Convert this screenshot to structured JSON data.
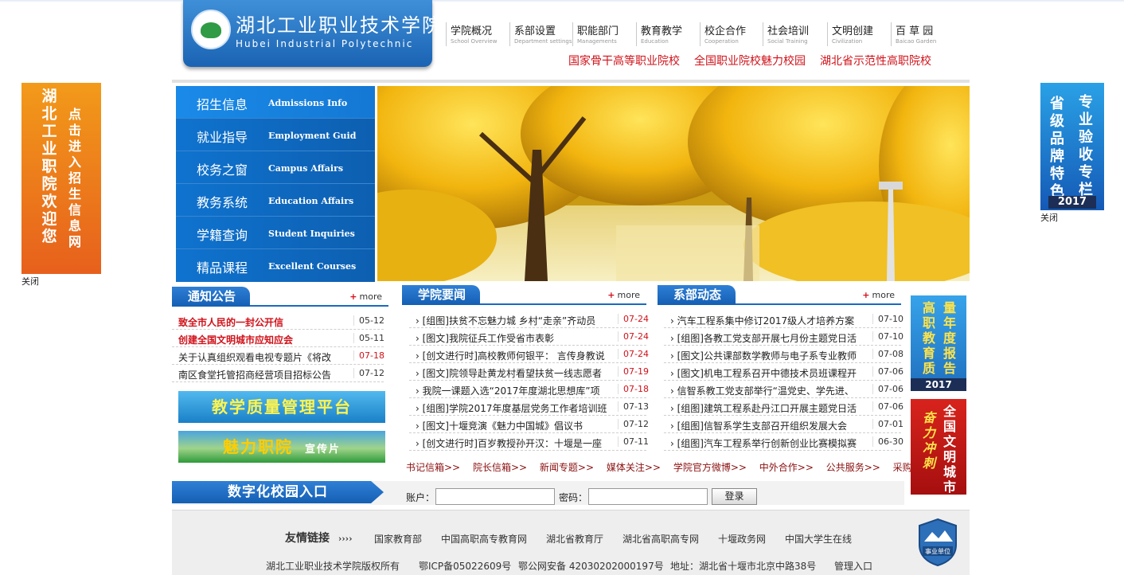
{
  "header": {
    "logo_cn": "湖北工业职业技术学院",
    "logo_en": "Hubei Industrial Polytechnic",
    "nav": [
      {
        "cn": "学院概况",
        "en": "School Overview"
      },
      {
        "cn": "系部设置",
        "en": "Department settings"
      },
      {
        "cn": "职能部门",
        "en": "Managements"
      },
      {
        "cn": "教育教学",
        "en": "Education"
      },
      {
        "cn": "校企合作",
        "en": "Cooperation"
      },
      {
        "cn": "社会培训",
        "en": "Social Training"
      },
      {
        "cn": "文明创建",
        "en": "Civilization"
      },
      {
        "cn": "百 草 园",
        "en": "Baicao Garden"
      }
    ],
    "slogans": [
      "国家骨干高等职业院校",
      "全国职业院校魅力校园",
      "湖北省示范性高职院校"
    ]
  },
  "side_menu": [
    {
      "cn": "招生信息",
      "en": "Admissions Info"
    },
    {
      "cn": "就业指导",
      "en": "Employment Guid"
    },
    {
      "cn": "校务之窗",
      "en": "Campus Affairs"
    },
    {
      "cn": "教务系统",
      "en": "Education Affairs"
    },
    {
      "cn": "学籍查询",
      "en": "Student Inquiries"
    },
    {
      "cn": "精品课程",
      "en": "Excellent Courses"
    }
  ],
  "float_left": {
    "text1": "湖北工业职院欢迎您",
    "text2": "点击进入招生信息网",
    "close": "关闭"
  },
  "float_right": {
    "text1": "省级品牌特色",
    "text2": "专业验收专栏",
    "year": "2017",
    "close": "关闭"
  },
  "notice": {
    "title": "通知公告",
    "more": "more",
    "items": [
      {
        "title": "致全市人民的一封公开信",
        "date": "05-12",
        "title_red": true,
        "date_red": false
      },
      {
        "title": "创建全国文明城市应知应会",
        "date": "05-11",
        "title_red": true,
        "date_red": false
      },
      {
        "title": "关于认真组织观看电视专题片《将改",
        "date": "07-18",
        "title_red": false,
        "date_red": true
      },
      {
        "title": "南区食堂托管招商经营项目招标公告",
        "date": "07-12",
        "title_red": false,
        "date_red": false
      }
    ],
    "banner1": "教学质量管理平台",
    "banner2": "魅力职院",
    "banner2_sub": "宣传片"
  },
  "college_news": {
    "title": "学院要闻",
    "more": "more",
    "items": [
      {
        "title": "[组图]扶贫不忘魅力城 乡村“走亲”齐动员",
        "date": "07-24",
        "date_red": true
      },
      {
        "title": "[图文]我院征兵工作受省市表彰",
        "date": "07-24",
        "date_red": true
      },
      {
        "title": "[创文进行时]高校教师何银平： 言传身教说",
        "date": "07-24",
        "date_red": true
      },
      {
        "title": "[图文]院领导赴黄龙村看望扶贫一线志愿者",
        "date": "07-19",
        "date_red": true
      },
      {
        "title": "我院一课题入选“2017年度湖北思想库”项",
        "date": "07-18",
        "date_red": true
      },
      {
        "title": "[组图]学院2017年度基层党务工作者培训班",
        "date": "07-13",
        "date_red": false
      },
      {
        "title": "[图文]十堰竞演《魅力中国城》倡议书",
        "date": "07-12",
        "date_red": false
      },
      {
        "title": "[创文进行时]百岁教授孙开汉：十堰是一座",
        "date": "07-11",
        "date_red": false
      }
    ]
  },
  "dept_news": {
    "title": "系部动态",
    "more": "more",
    "items": [
      {
        "title": "汽车工程系集中修订2017级人才培养方案",
        "date": "07-10"
      },
      {
        "title": "[组图]各教工党支部开展七月份主题党日活",
        "date": "07-10"
      },
      {
        "title": "[图文]公共课部数学教师与电子系专业教师",
        "date": "07-08"
      },
      {
        "title": "[图文]机电工程系召开中德技术员班课程开",
        "date": "07-06"
      },
      {
        "title": "信智系教工党支部举行“温党史、学先进、",
        "date": "07-06"
      },
      {
        "title": "[组图]建筑工程系赴丹江口开展主题党日活",
        "date": "07-06"
      },
      {
        "title": "[组图]信智系学生支部召开组织发展大会",
        "date": "07-01"
      },
      {
        "title": "[组图]汽车工程系举行创新创业比赛模拟赛",
        "date": "06-30"
      }
    ]
  },
  "quick_links": [
    "书记信箱>>",
    "院长信箱>>",
    "新闻专题>>",
    "媒体关注>>",
    "学院官方微博>>",
    "中外合作>>",
    "公共服务>>",
    "采购公告>>"
  ],
  "login": {
    "campus_entry": "数字化校园入口",
    "account_label": "账户：",
    "password_label": "密码：",
    "login_button": "登录"
  },
  "right_ads": {
    "ad1_text1": "高职教育质",
    "ad1_text2": "量年度报告",
    "ad1_year": "2017",
    "ad2_text1": "全国文明城市",
    "ad2_text2": "奋力冲刺"
  },
  "footer": {
    "friend_title": "友情链接",
    "friend_arrows": "››››",
    "links": [
      "国家教育部",
      "中国高职高专教育网",
      "湖北省教育厅",
      "湖北省高职高专网",
      "十堰政务网",
      "中国大学生在线"
    ],
    "copyright": "湖北工业职业技术学院版权所有",
    "icp": "鄂ICP备05022609号",
    "police": "鄂公网安备 42030202000197号",
    "address": "地址：湖北省十堰市北京中路38号",
    "admin": "管理入口",
    "badge": "事业单位"
  },
  "colors": {
    "brand_blue": "#1a63b3",
    "accent_red": "#d0121a"
  }
}
